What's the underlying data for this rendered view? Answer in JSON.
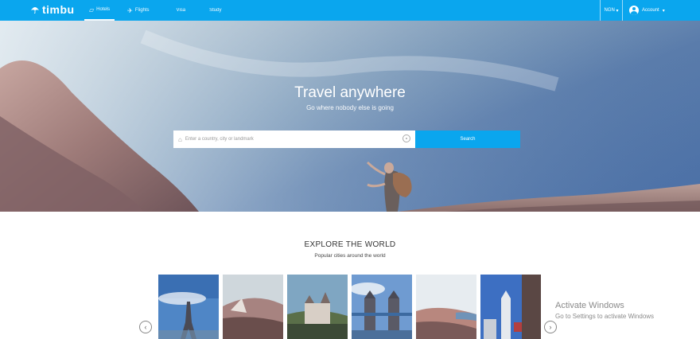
{
  "brand": {
    "name": "timbu"
  },
  "nav": {
    "items": [
      {
        "label": "Hotels",
        "icon": "hotel-icon",
        "active": true
      },
      {
        "label": "Flights",
        "icon": "plane-icon",
        "active": false
      },
      {
        "label": "Visa",
        "icon": "",
        "active": false
      },
      {
        "label": "Study",
        "icon": "",
        "active": false
      }
    ],
    "currency": "NGN",
    "account": "Account"
  },
  "hero": {
    "title": "Travel anywhere",
    "subtitle": "Go where nobody else is going",
    "search": {
      "placeholder": "Enter a country, city or landmark",
      "button": "Search"
    }
  },
  "explore": {
    "title": "EXPLORE THE WORLD",
    "subtitle": "Popular cities around the world"
  },
  "watermark": {
    "title": "Activate Windows",
    "subtitle": "Go to Settings to activate Windows"
  },
  "colors": {
    "primary": "#0aa6ee"
  }
}
